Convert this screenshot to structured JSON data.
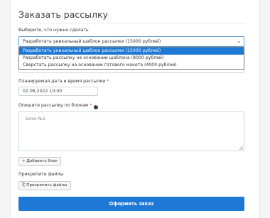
{
  "form": {
    "title": "Заказать рассылку",
    "service_label": "Выберите, что нужно сделать",
    "service_selected": "Разработать уникальный шаблон рассылки (15000 рублей)",
    "service_options": [
      "Разработать уникальный шаблон рассылки (15000 рублей)",
      "Разработать рассылку на основании шаблона (8000 рублей)",
      "Сверстать рассылку на основании готового макета (4000 рублей)"
    ],
    "date_label": "Планируемая дата и время рассылки",
    "date_value": "02.06.2022 10:00",
    "description_label": "Опишите рассылку по блокам",
    "description_placeholder": "Блок №1",
    "add_block_label": "+ Добавить блок",
    "attach_label": "Прикрепите файлы",
    "attach_button": "Прикрепить файлы",
    "submit_label": "Оформить заказ",
    "required_mark": "*"
  }
}
